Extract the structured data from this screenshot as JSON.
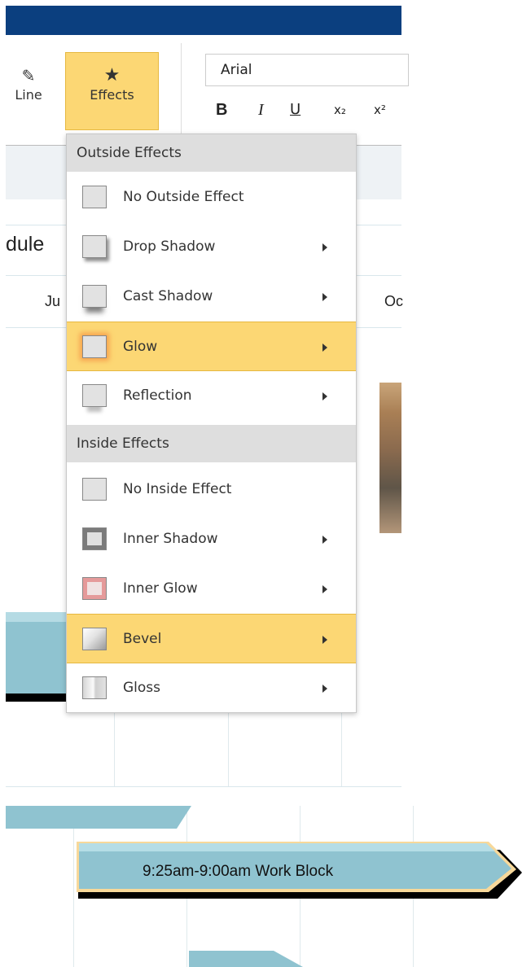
{
  "ribbon": {
    "line_label": "Line",
    "effects_label": "Effects",
    "font_name": "Arial",
    "bold": "B",
    "italic": "I",
    "underline": "U",
    "subscript": "x₂",
    "superscript": "x²"
  },
  "background": {
    "schedule_text": "dule",
    "month_left": "Ju",
    "month_right": "Oc",
    "bar_label": "9:25am-9:00am Work Block"
  },
  "menu": {
    "outside_header": "Outside Effects",
    "inside_header": "Inside Effects",
    "items": {
      "no_outside": "No Outside Effect",
      "drop_shadow": "Drop Shadow",
      "cast_shadow": "Cast Shadow",
      "glow": "Glow",
      "reflection": "Reflection",
      "no_inside": "No Inside Effect",
      "inner_shadow": "Inner Shadow",
      "inner_glow": "Inner Glow",
      "bevel": "Bevel",
      "gloss": "Gloss"
    }
  },
  "colors": {
    "top_bar": "#0b3f7f",
    "highlight": "#fcd774",
    "bar_fill": "#8fc3d0"
  }
}
